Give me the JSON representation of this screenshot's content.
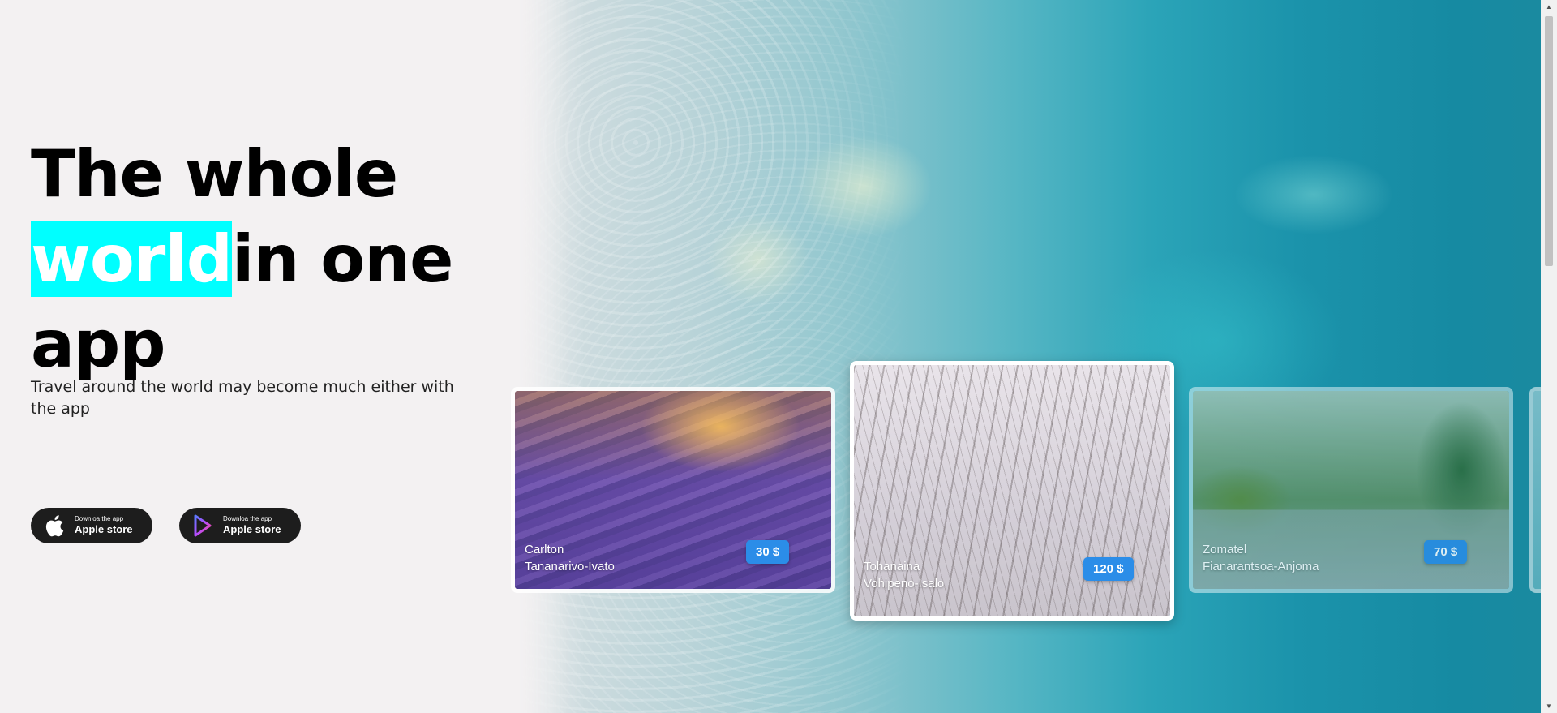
{
  "hero": {
    "title_line1": "The whole",
    "title_highlight": "world",
    "title_line2_rest": "in one",
    "title_line3": "app",
    "subtitle": "Travel around the world may become much either with the app",
    "highlight_color": "#00ffff"
  },
  "store_buttons": [
    {
      "icon": "apple-icon",
      "small_label": "Downloa the app",
      "label": "Apple store"
    },
    {
      "icon": "play-store-icon",
      "small_label": "Downloa the app",
      "label": "Apple store"
    }
  ],
  "cards": [
    {
      "line1": "Carlton",
      "line2": "Tananarivo-Ivato",
      "price": "30 $"
    },
    {
      "line1": "Tohanaina",
      "line2": "Vohipeno-Isalo",
      "price": "120 $"
    },
    {
      "line1": "Zomatel",
      "line2": "Fianarantsoa-Anjoma",
      "price": "70 $"
    }
  ],
  "colors": {
    "background": "#f3f1f2",
    "price_badge": "#2b8de8",
    "store_button": "#1d1d1d"
  }
}
